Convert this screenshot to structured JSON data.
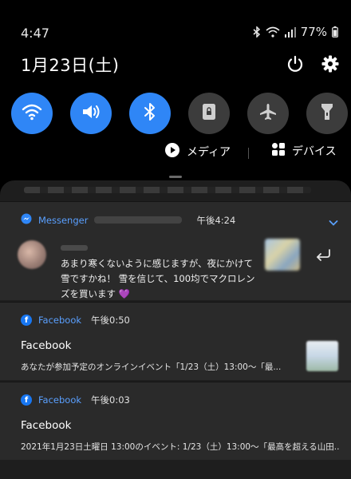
{
  "status_bar": {
    "time": "4:47",
    "battery": "77%"
  },
  "header": {
    "date": "1月23日(土)"
  },
  "quick_settings": {
    "tiles": [
      {
        "name": "wifi",
        "state": "on"
      },
      {
        "name": "sound",
        "state": "on"
      },
      {
        "name": "bluetooth",
        "state": "on"
      },
      {
        "name": "screen-lock",
        "state": "off"
      },
      {
        "name": "airplane",
        "state": "off"
      },
      {
        "name": "flashlight",
        "state": "off"
      }
    ],
    "media_label": "メディア",
    "devices_label": "デバイス"
  },
  "notifications": [
    {
      "app": "Messenger",
      "time": "午後4:24",
      "body": "あまり寒くないように感じますが、夜にかけて雪ですかね！ 雪を信じて、100均でマクロレンズを買います 💜"
    },
    {
      "app": "Facebook",
      "time": "午後0:50",
      "title": "Facebook",
      "body": "あなたが参加予定のオンラインイベント「1/23（土）13:00〜「最..."
    },
    {
      "app": "Facebook",
      "time": "午後0:03",
      "title": "Facebook",
      "body": "2021年1月23日土曜日 13:00のイベント: 1/23（土）13:00〜「最高を超える山田..."
    }
  ],
  "colors": {
    "accent": "#2f86f6",
    "tile_off": "#3c3c3c",
    "panel": "#1e1e1e",
    "card": "#2a2a2a",
    "app_name": "#5aa0ff"
  }
}
